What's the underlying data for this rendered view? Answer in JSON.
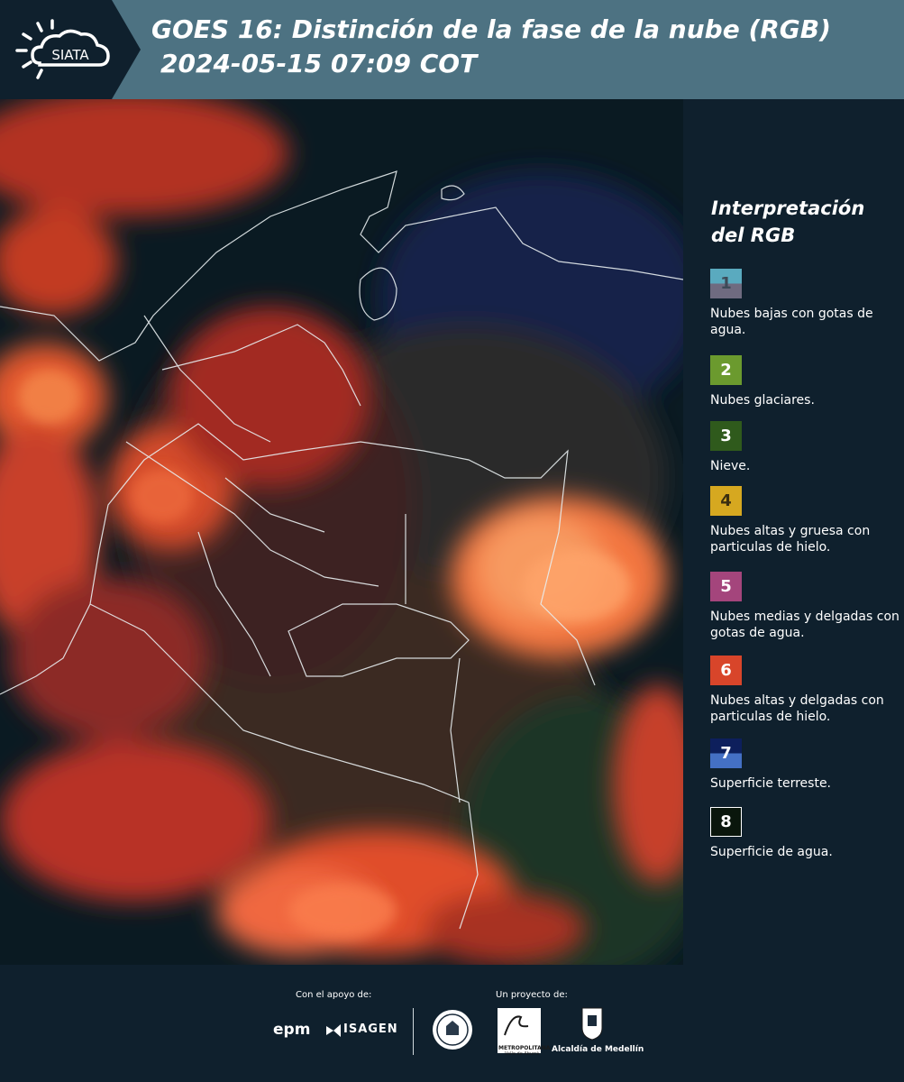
{
  "header": {
    "logo_text": "SIATA",
    "title_line1": "GOES 16: Distinción de la fase de la nube (RGB)",
    "title_line2": "2024-05-15 07:09 COT"
  },
  "legend": {
    "title": "Interpretación del RGB",
    "items": [
      {
        "number": "1",
        "label": "Nubes bajas con gotas de agua.",
        "colors": [
          "#5aaabf",
          "#6f6b80"
        ]
      },
      {
        "number": "2",
        "label": "Nubes glaciares.",
        "colors": [
          "#6b9a2e"
        ]
      },
      {
        "number": "3",
        "label": "Nieve.",
        "colors": [
          "#2f5a1c"
        ]
      },
      {
        "number": "4",
        "label": "Nubes altas y gruesa con particulas de hielo.",
        "colors": [
          "#d6a820"
        ]
      },
      {
        "number": "5",
        "label": "Nubes medias y delgadas con gotas de agua.",
        "colors": [
          "#a4457c"
        ]
      },
      {
        "number": "6",
        "label": "Nubes altas y delgadas con particulas de hielo.",
        "colors": [
          "#d8452a"
        ]
      },
      {
        "number": "7",
        "label": "Superficie terreste.",
        "colors": [
          "#0d1f5c",
          "#4470c4"
        ]
      },
      {
        "number": "8",
        "label": "Superficie de agua.",
        "colors": [
          "#0a160c"
        ]
      }
    ]
  },
  "footer": {
    "support_label": "Con el apoyo de:",
    "project_label": "Un proyecto de:",
    "sponsor1": "epm",
    "sponsor2": "ISAGEN",
    "inst_area_1": "METROPOLITANA",
    "inst_area_2": "Valle de Aburrá",
    "inst_alcaldia": "Alcaldía de Medellín"
  }
}
